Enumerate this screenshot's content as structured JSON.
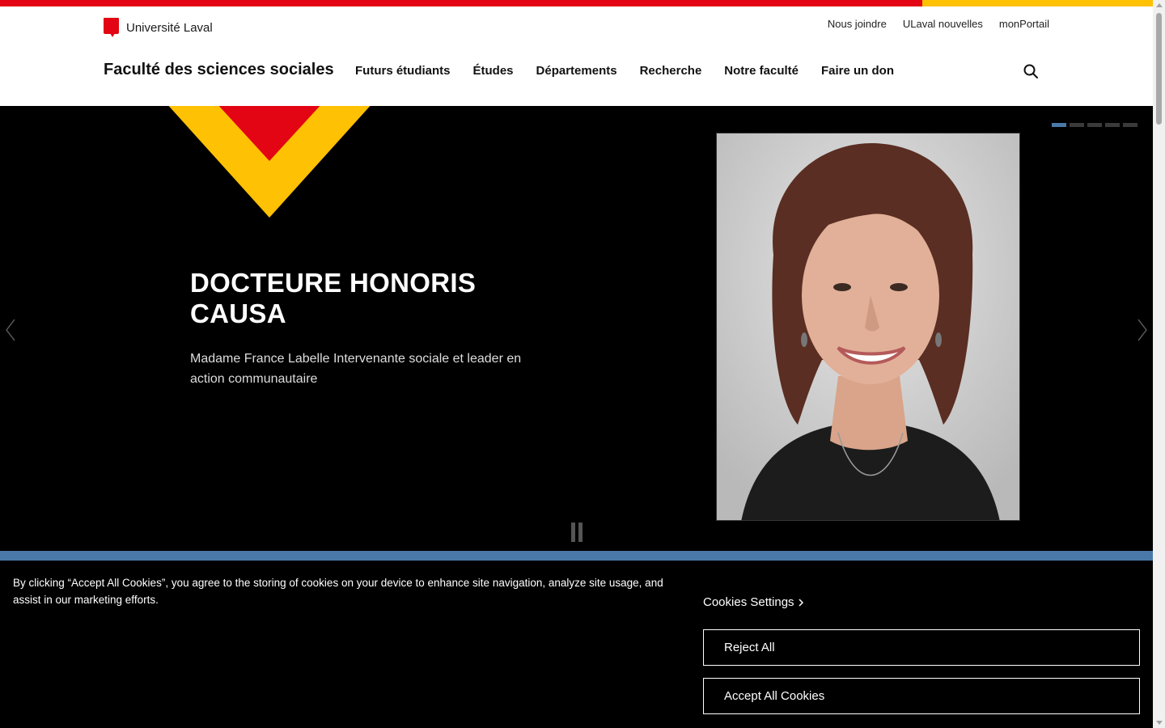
{
  "colors": {
    "brand_red": "#e30513",
    "brand_yellow": "#ffc103",
    "accent_blue": "#4a78a8",
    "hero_bg": "#000000"
  },
  "header": {
    "university_name": "Université Laval",
    "utility_links": [
      "Nous joindre",
      "ULaval nouvelles",
      "monPortail"
    ],
    "faculty_name": "Faculté des sciences sociales",
    "nav_items": [
      "Futurs étudiants",
      "Études",
      "Départements",
      "Recherche",
      "Notre faculté",
      "Faire un don"
    ],
    "search_icon": "search-icon"
  },
  "hero": {
    "title": "DOCTEURE HONORIS CAUSA",
    "description": "Madame France Labelle Intervenante sociale et leader en action communautaire",
    "slide_count": 5,
    "active_slide": 1,
    "prev_icon": "chevron-left-icon",
    "next_icon": "chevron-right-icon",
    "pause_icon": "pause-icon"
  },
  "cookie_banner": {
    "text": "By clicking “Accept All Cookies”, you agree to the storing of cookies on your device to enhance site navigation, analyze site usage, and assist in our marketing efforts.",
    "settings_label": "Cookies Settings",
    "reject_label": "Reject All",
    "accept_label": "Accept All Cookies"
  }
}
